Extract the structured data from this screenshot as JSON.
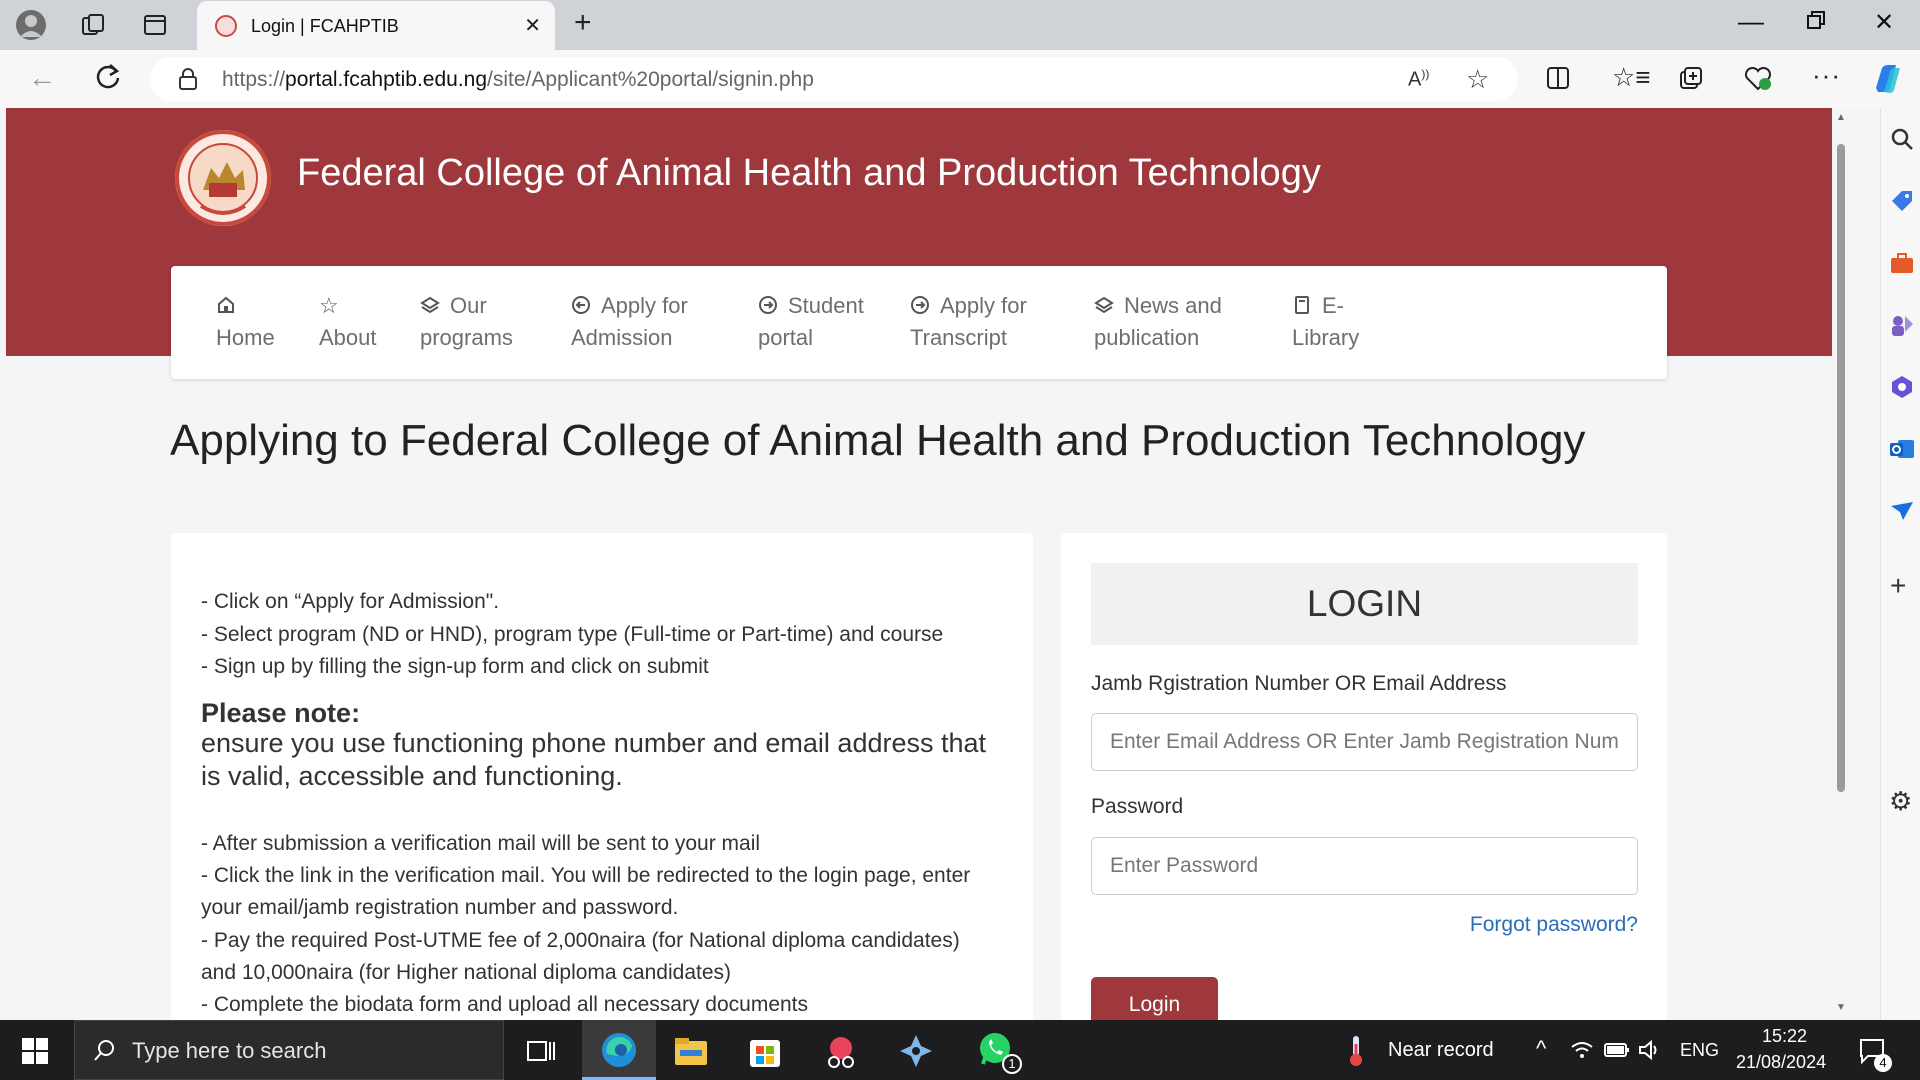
{
  "browser": {
    "tab_title": "Login | FCAHPTIB",
    "url_prefix": "https://",
    "url_domain": "portal.fcahptib.edu.ng",
    "url_path": "/site/Applicant%20portal/signin.php"
  },
  "header": {
    "college_name": "Federal College of Animal Health and Production Technology"
  },
  "nav": [
    {
      "line1": "Home",
      "line2": ""
    },
    {
      "line1": "About",
      "line2": ""
    },
    {
      "line1": "Our",
      "line2": "programs"
    },
    {
      "line1": "Apply for",
      "line2": "Admission"
    },
    {
      "line1": "Student",
      "line2": "portal"
    },
    {
      "line1": "Apply for",
      "line2": "Transcript"
    },
    {
      "line1": "News and",
      "line2": "publication"
    },
    {
      "line1": "E-",
      "line2": "Library"
    }
  ],
  "main": {
    "heading": "Applying to Federal College of Animal Health and Production Technology"
  },
  "instructions": {
    "steps_before": [
      "- Click on “Apply for Admission\".",
      "- Select program (ND or HND), program type (Full-time or Part-time) and course",
      "- Sign up by filling the sign-up form and click on submit"
    ],
    "note_heading": "Please note:",
    "note_text": "ensure you use functioning phone number and email address that is valid, accessible and functioning.",
    "steps_after": [
      "- After submission a verification mail will be sent to your mail",
      "- Click the link in the verification mail. You will be redirected to the login page, enter",
      "your email/jamb registration number and password.",
      "- Pay the required Post-UTME fee of 2,000naira (for National diploma candidates)",
      "and 10,000naira (for Higher national diploma candidates)",
      "- Complete the biodata form and upload all necessary documents"
    ]
  },
  "login": {
    "title": "LOGIN",
    "id_label": "Jamb Rgistration Number OR Email Address",
    "id_placeholder": "Enter Email Address OR Enter Jamb Registration Number",
    "password_label": "Password",
    "password_placeholder": "Enter Password",
    "forgot": "Forgot password?",
    "button": "Login"
  },
  "taskbar": {
    "search_placeholder": "Type here to search",
    "weather": "Near record",
    "language": "ENG",
    "time": "15:22",
    "date": "21/08/2024",
    "notification_count": "4",
    "whatsapp_badge": "1"
  },
  "colors": {
    "brand": "#9e383c",
    "link": "#2a6db8"
  }
}
